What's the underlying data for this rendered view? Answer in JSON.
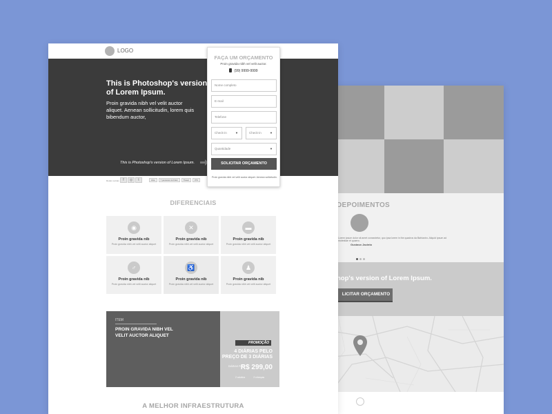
{
  "header": {
    "logo": "LOGO"
  },
  "hero": {
    "title": "This is Photoshop's version  of Lorem Ipsum.",
    "subtitle": "Proin gravida nibh vel velit auctor aliquet. Aenean sollicitudin, lorem quis bibendum auctor,",
    "caption": "This is Photoshop's version  of Lorem Ipsum."
  },
  "social": {
    "label": "Redes sociais",
    "icons": [
      "f",
      "◎",
      "t"
    ],
    "buttons": [
      "Like",
      "7 pessoas curtiram",
      "Tweet",
      "374"
    ]
  },
  "form": {
    "title": "FAÇA UM ORÇAMENTO",
    "subtitle": "Proin gravida nibh vel velit auctor.",
    "phone": "(99) 9999-9999",
    "name_placeholder": "Nome completo",
    "email_placeholder": "E-mail",
    "phone_placeholder": "Telefone",
    "checkin_placeholder": "Check-in",
    "checkout_placeholder": "Check-in",
    "quantity_placeholder": "Quantidade",
    "submit": "SOLICITAR ORÇAMENTO",
    "note": "Proin gravida nibh vel velit auctor aliquet. Aenean sollicitudin."
  },
  "features": {
    "title": "DIFERENCIAIS",
    "items": [
      {
        "icon": "wifi-icon",
        "glyph": "◉",
        "title": "Proin gravida nib",
        "desc": "Proin gravida nibh vel velit auctor aliquet"
      },
      {
        "icon": "restaurant-icon",
        "glyph": "✕",
        "title": "Proin gravida nib",
        "desc": "Proin gravida nibh vel velit auctor aliquet"
      },
      {
        "icon": "bed-icon",
        "glyph": "▬",
        "title": "Proin gravida nib",
        "desc": "Proin gravida nibh vel velit auctor aliquet"
      },
      {
        "icon": "restroom-icon",
        "glyph": "♂",
        "title": "Proin gravida nib",
        "desc": "Proin gravida nibh vel velit auctor aliquet"
      },
      {
        "icon": "accessibility-icon",
        "glyph": "♿",
        "title": "Proin gravida nib",
        "desc": "Proin gravida nibh vel velit auctor aliquet"
      },
      {
        "icon": "person-icon",
        "glyph": "♟",
        "title": "Proin gravida nib",
        "desc": "Proin gravida nibh vel velit auctor aliquet"
      }
    ]
  },
  "promo": {
    "item_label": "ITEM",
    "title": "PROIN GRAVIDA NIBH VEL VELIT AUCTOR ALIQUET",
    "tag": "PROMOÇÃO",
    "offer_line1": "4 DIÁRIAS PELO",
    "offer_line2": "PREÇO DE 3 DIÁRIAS",
    "from_label": "DIÁRIAS POR",
    "price": "R$ 299,00",
    "foot1": "2 adultos",
    "foot2": "2 crianças"
  },
  "infra": {
    "title": "A MELHOR INFRAESTRUTURA"
  },
  "back": {
    "testimonials_title": "DEPOIMENTOS",
    "quote": "Lorem ipsum dolor sit amet consectetur, quo ipsa lorem in the quadros da Bahianiro. Aliquid ipsum ad molestiae et quaero.",
    "author": "Gustavo Jacinto",
    "cta_text": "hop's version  of Lorem Ipsum.",
    "cta_button": "LICITAR ORÇAMENTO"
  }
}
